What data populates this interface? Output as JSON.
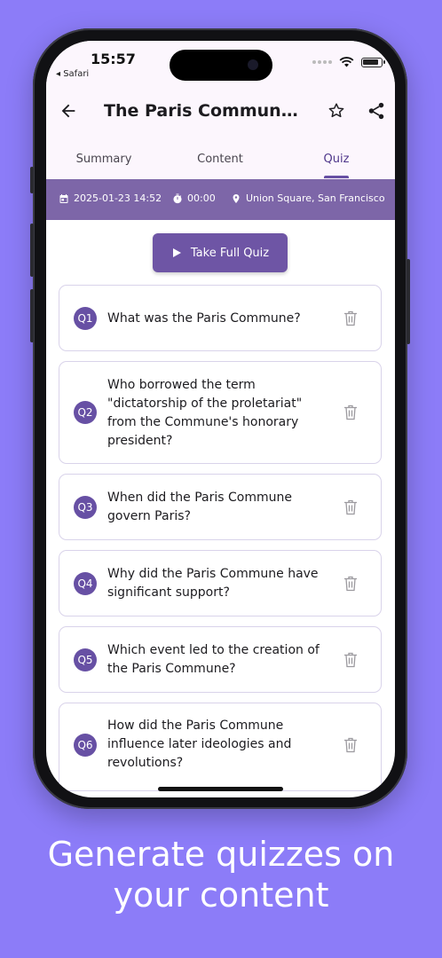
{
  "status_bar": {
    "time": "15:57",
    "back_app": "◂ Safari"
  },
  "app_bar": {
    "title": "The Paris Commune: ...",
    "back_icon": "arrow-left-icon",
    "favorite_icon": "star-icon",
    "share_icon": "share-icon"
  },
  "tabs": [
    {
      "label": "Summary",
      "active": false
    },
    {
      "label": "Content",
      "active": false
    },
    {
      "label": "Quiz",
      "active": true
    }
  ],
  "info_bar": {
    "date": "2025-01-23 14:52",
    "duration": "00:00",
    "location": "Union Square, San Francisco"
  },
  "take_quiz": {
    "label": "Take Full Quiz"
  },
  "questions": [
    {
      "badge": "Q1",
      "text": "What was the Paris Commune?"
    },
    {
      "badge": "Q2",
      "text": "Who borrowed the term \"dictatorship of the proletariat\" from the Commune's honorary president?"
    },
    {
      "badge": "Q3",
      "text": "When did the Paris Commune govern Paris?"
    },
    {
      "badge": "Q4",
      "text": "Why did the Paris Commune have significant support?"
    },
    {
      "badge": "Q5",
      "text": "Which event led to the creation of the Paris Commune?"
    },
    {
      "badge": "Q6",
      "text": "How did the Paris Commune influence later ideologies and revolutions?"
    }
  ],
  "caption": {
    "line1": "Generate quizzes on",
    "line2": "your content"
  },
  "colors": {
    "background": "#8c7cf8",
    "primary": "#6750a4",
    "info_bar": "#7d66a8",
    "app_bar": "#fcf6fd"
  }
}
